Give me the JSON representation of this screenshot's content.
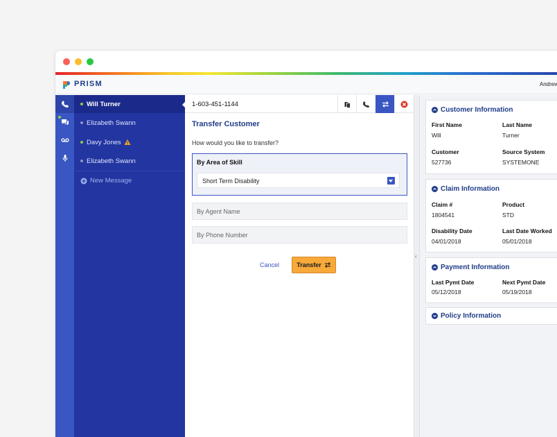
{
  "app": {
    "brand": "PRISM",
    "user": "Andrew Ba"
  },
  "conversations": [
    {
      "name": "Will Turner",
      "active": true,
      "online": true
    },
    {
      "name": "Elizabeth Swann",
      "online": false
    },
    {
      "name": "Davy Jones",
      "online": true,
      "warning": true
    },
    {
      "name": "Elizabeth Swann",
      "online": false
    }
  ],
  "new_message": "New Message",
  "call": {
    "phone": "1-603-451-1144"
  },
  "transfer": {
    "title": "Transfer Customer",
    "question": "How would you like to transfer?",
    "skill_label": "By Area of Skill",
    "skill_value": "Short Term Disability",
    "agent_placeholder": "By Agent Name",
    "phone_placeholder": "By Phone Number",
    "cancel": "Cancel",
    "submit": "Transfer"
  },
  "customer": {
    "title": "Customer Information",
    "first_name_label": "First Name",
    "first_name": "Will",
    "last_name_label": "Last Name",
    "last_name": "Turner",
    "customer_label": "Customer",
    "customer_id": "527736",
    "source_label": "Source System",
    "source": "SYSTEMONE"
  },
  "claim": {
    "title": "Claim Information",
    "claim_label": "Claim #",
    "claim_no": "1804541",
    "product_label": "Product",
    "product": "STD",
    "dis_date_label": "Disability Date",
    "dis_date": "04/01/2018",
    "last_worked_label": "Last Date Worked",
    "last_worked": "05/01/2018"
  },
  "payment": {
    "title": "Payment Information",
    "last_label": "Last Pymt Date",
    "last": "05/12/2018",
    "next_label": "Next Pymt Date",
    "next": "05/19/2018"
  },
  "policy": {
    "title": "Policy Information"
  },
  "colors": {
    "primary": "#3a56c3",
    "sidebar": "#2235a0",
    "accent": "#f7a93a",
    "heading": "#1f3c88"
  }
}
